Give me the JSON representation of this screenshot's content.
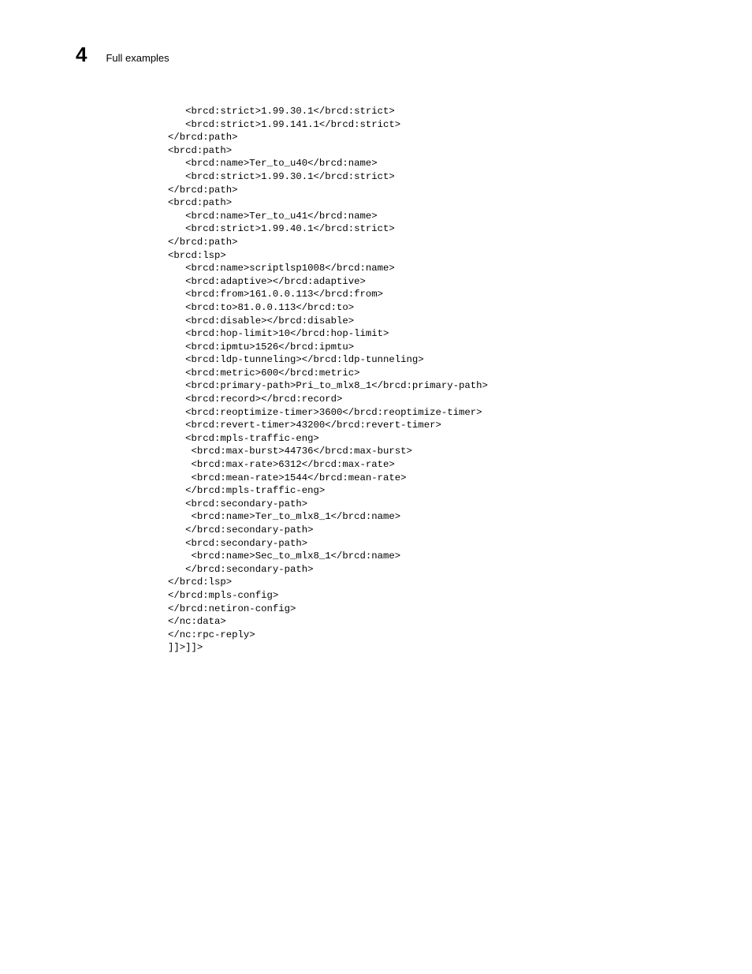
{
  "header": {
    "chapter": "4",
    "title": "Full examples"
  },
  "code": "   <brcd:strict>1.99.30.1</brcd:strict>\n   <brcd:strict>1.99.141.1</brcd:strict>\n</brcd:path>\n<brcd:path>\n   <brcd:name>Ter_to_u40</brcd:name>\n   <brcd:strict>1.99.30.1</brcd:strict>\n</brcd:path>\n<brcd:path>\n   <brcd:name>Ter_to_u41</brcd:name>\n   <brcd:strict>1.99.40.1</brcd:strict>\n</brcd:path>\n<brcd:lsp>\n   <brcd:name>scriptlsp1008</brcd:name>\n   <brcd:adaptive></brcd:adaptive>\n   <brcd:from>161.0.0.113</brcd:from>\n   <brcd:to>81.0.0.113</brcd:to>\n   <brcd:disable></brcd:disable>\n   <brcd:hop-limit>10</brcd:hop-limit>\n   <brcd:ipmtu>1526</brcd:ipmtu>\n   <brcd:ldp-tunneling></brcd:ldp-tunneling>\n   <brcd:metric>600</brcd:metric>\n   <brcd:primary-path>Pri_to_mlx8_1</brcd:primary-path>\n   <brcd:record></brcd:record>\n   <brcd:reoptimize-timer>3600</brcd:reoptimize-timer>\n   <brcd:revert-timer>43200</brcd:revert-timer>\n   <brcd:mpls-traffic-eng>\n    <brcd:max-burst>44736</brcd:max-burst>\n    <brcd:max-rate>6312</brcd:max-rate>\n    <brcd:mean-rate>1544</brcd:mean-rate>\n   </brcd:mpls-traffic-eng>\n   <brcd:secondary-path>\n    <brcd:name>Ter_to_mlx8_1</brcd:name>\n   </brcd:secondary-path>\n   <brcd:secondary-path>\n    <brcd:name>Sec_to_mlx8_1</brcd:name>\n   </brcd:secondary-path>\n</brcd:lsp>\n</brcd:mpls-config>\n</brcd:netiron-config>\n</nc:data>\n</nc:rpc-reply>\n]]>]]>"
}
